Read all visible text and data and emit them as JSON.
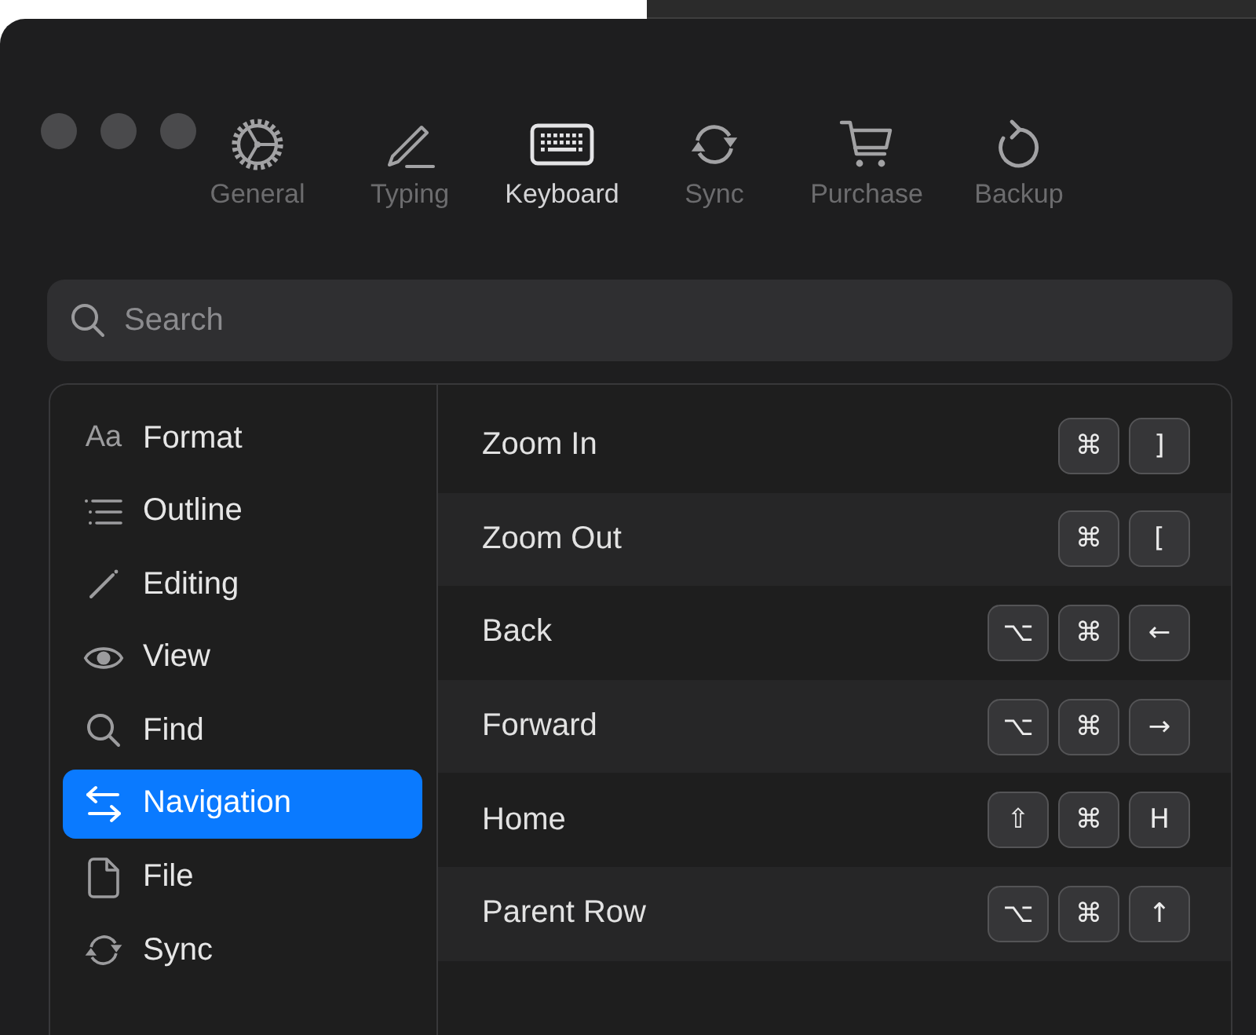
{
  "toolbar": {
    "items": [
      {
        "label": "General",
        "selected": false
      },
      {
        "label": "Typing",
        "selected": false
      },
      {
        "label": "Keyboard",
        "selected": true
      },
      {
        "label": "Sync",
        "selected": false
      },
      {
        "label": "Purchase",
        "selected": false
      },
      {
        "label": "Backup",
        "selected": false
      }
    ]
  },
  "search": {
    "placeholder": "Search"
  },
  "sidebar": {
    "items": [
      {
        "label": "Format",
        "icon_text": "Aa",
        "selected": false
      },
      {
        "label": "Outline",
        "selected": false
      },
      {
        "label": "Editing",
        "selected": false
      },
      {
        "label": "View",
        "selected": false
      },
      {
        "label": "Find",
        "selected": false
      },
      {
        "label": "Navigation",
        "selected": true
      },
      {
        "label": "File",
        "selected": false
      },
      {
        "label": "Sync",
        "selected": false
      }
    ]
  },
  "shortcuts": {
    "rows": [
      {
        "label": "Zoom In",
        "keys": [
          "⌘",
          "]"
        ]
      },
      {
        "label": "Zoom Out",
        "keys": [
          "⌘",
          "["
        ]
      },
      {
        "label": "Back",
        "keys": [
          "⌥",
          "⌘",
          "←"
        ]
      },
      {
        "label": "Forward",
        "keys": [
          "⌥",
          "⌘",
          "→"
        ]
      },
      {
        "label": "Home",
        "keys": [
          "⇧",
          "⌘",
          "H"
        ]
      },
      {
        "label": "Parent Row",
        "keys": [
          "⌥",
          "⌘",
          "↑"
        ]
      }
    ]
  }
}
